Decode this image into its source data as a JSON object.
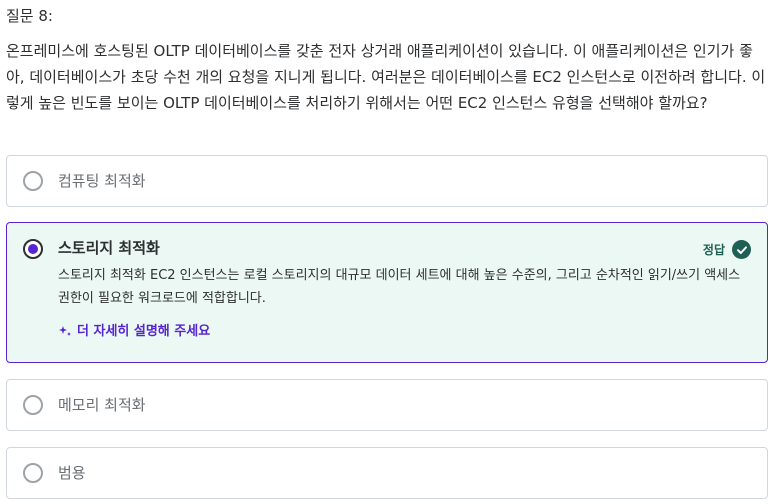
{
  "question": {
    "number_label": "질문 8:",
    "text": "온프레미스에 호스팅된 OLTP 데이터베이스를 갖춘 전자 상거래 애플리케이션이 있습니다. 이 애플리케이션은 인기가 좋아, 데이터베이스가 초당 수천 개의 요청을 지니게 됩니다. 여러분은 데이터베이스를 EC2 인스턴스로 이전하려 합니다. 이렇게 높은 빈도를 보이는 OLTP 데이터베이스를 처리하기 위해서는 어떤 EC2 인스턴스 유형을 선택해야 할까요?"
  },
  "options": [
    {
      "label": "컴퓨팅 최적화"
    },
    {
      "label": "스토리지 최적화",
      "correct_label": "정답",
      "explanation": "스토리지 최적화 EC2 인스턴스는 로컬 스토리지의 대규모 데이터 세트에 대해 높은 수준의, 그리고 순차적인 읽기/쓰기 액세스 권한이 필요한 워크로드에 적합합니다.",
      "explain_more": "더 자세히 설명해 주세요"
    },
    {
      "label": "메모리 최적화"
    },
    {
      "label": "범용"
    }
  ],
  "colors": {
    "accent": "#5624d0",
    "correct": "#1e6055",
    "selected_bg": "#ebf8f3",
    "border": "#d1d7dc",
    "muted_text": "#6a6f73"
  },
  "icons": {
    "radio_empty": "radio-unchecked-icon",
    "radio_selected": "radio-checked-icon",
    "correct": "check-circle-icon",
    "explain": "sparkle-icon"
  }
}
